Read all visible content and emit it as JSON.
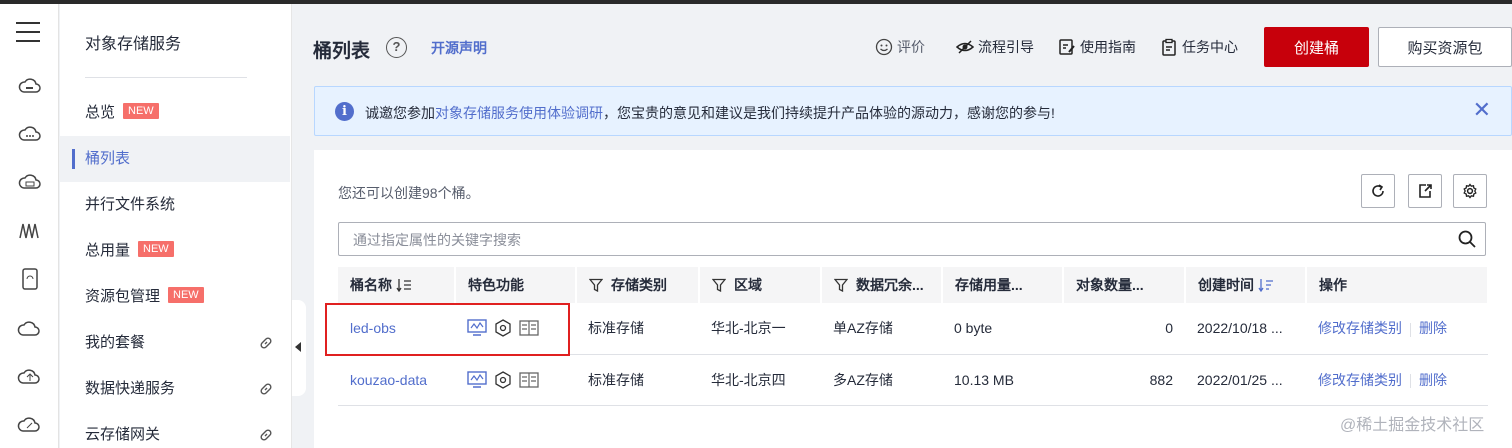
{
  "sidebar": {
    "title": "对象存储服务",
    "items": [
      {
        "label": "总览",
        "badge": "NEW"
      },
      {
        "label": "桶列表"
      },
      {
        "label": "并行文件系统"
      },
      {
        "label": "总用量",
        "badge": "NEW"
      },
      {
        "label": "资源包管理",
        "badge": "NEW"
      },
      {
        "label": "我的套餐"
      },
      {
        "label": "数据快递服务"
      },
      {
        "label": "云存储网关"
      }
    ]
  },
  "header": {
    "title": "桶列表",
    "help": "?",
    "open_source": "开源声明",
    "tools": [
      "评价",
      "流程引导",
      "使用指南",
      "任务中心"
    ],
    "create_button": "创建桶",
    "buy_button": "购买资源包"
  },
  "notice": {
    "icon": "i",
    "prefix": "诚邀您参加",
    "link": "对象存储服务使用体验调研",
    "suffix": "，您宝贵的意见和建议是我们持续提升产品体验的源动力，感谢您的参与!",
    "close": "✕"
  },
  "quota_text": "您还可以创建98个桶。",
  "search": {
    "placeholder": "通过指定属性的关键字搜索"
  },
  "table": {
    "headers": [
      "桶名称",
      "特色功能",
      "存储类别",
      "区域",
      "数据冗余...",
      "存储用量...",
      "对象数量...",
      "创建时间",
      "操作"
    ],
    "rows": [
      {
        "name": "led-obs",
        "storage_class": "标准存储",
        "region": "华北-北京一",
        "redundancy": "单AZ存储",
        "usage": "0 byte",
        "objects": "0",
        "created": "2022/10/18 ...",
        "op1": "修改存储类别",
        "op2": "删除"
      },
      {
        "name": "kouzao-data",
        "storage_class": "标准存储",
        "region": "华北-北京四",
        "redundancy": "多AZ存储",
        "usage": "10.13 MB",
        "objects": "882",
        "created": "2022/01/25 ...",
        "op1": "修改存储类别",
        "op2": "删除"
      }
    ]
  },
  "watermark": "@稀土掘金技术社区",
  "colors": {
    "brand": "#c7000b",
    "link": "#526ecc",
    "badge": "#f66f6a",
    "highlight": "#e02020"
  }
}
